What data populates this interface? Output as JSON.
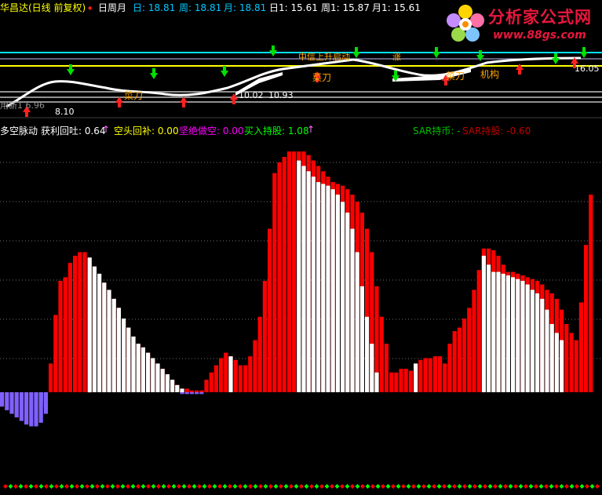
{
  "header": {
    "stock": "华昌达(日线 前复权)",
    "period_label": "日周月",
    "items": [
      {
        "label": "日: 18.81",
        "color": "#00c8ff"
      },
      {
        "label": "周: 18.81",
        "color": "#00c8ff"
      },
      {
        "label": "月: 18.81",
        "color": "#00c8ff"
      },
      {
        "label": "日1: 15.61",
        "color": "#ffffff"
      },
      {
        "label": "周1: 15.87",
        "color": "#ffffff"
      },
      {
        "label": "月1: 15.61",
        "color": "#ffffff"
      }
    ]
  },
  "logo": {
    "name": "分析家公式网",
    "url": "www.88gs.com"
  },
  "upper_labels": {
    "cut1": "菜刀",
    "cut2": "菜刀",
    "cut3": "菜刀",
    "inst": "机构",
    "p1": "8.10",
    "p2": "10.93",
    "p3": "16.05",
    "p4": "10.02",
    "left_text": "用新1 6.96",
    "zhongxin": "中信上升启动",
    "tail": "涨"
  },
  "indicator": {
    "name": "多空脉动",
    "items": [
      {
        "label": "获利回吐: 0.64",
        "color": "#ffffff"
      },
      {
        "label": "空头回补: 0.00",
        "color": "#ffff00"
      },
      {
        "label": "坚绝做空: 0.00",
        "color": "#ff00ff"
      },
      {
        "label": "买入持股: 1.08",
        "color": "#00ff00"
      },
      {
        "label": "SAR持币: -",
        "color": "#00c000"
      },
      {
        "label": "SAR持股: -0.60",
        "color": "#c00000"
      }
    ]
  },
  "chart_data": {
    "type": "bar",
    "title": "多空脉动",
    "series": [
      {
        "name": "买入持股",
        "color": "#ff0000",
        "values": [
          0,
          0,
          0,
          0,
          0,
          0,
          0,
          0,
          0,
          0,
          0.16,
          0.43,
          0.62,
          0.64,
          0.72,
          0.76,
          0.78,
          0.78,
          0.75,
          0.7,
          0.66,
          0.61,
          0.57,
          0.52,
          0.47,
          0.41,
          0.36,
          0.31,
          0.27,
          0.25,
          0.22,
          0.19,
          0.16,
          0.13,
          0.1,
          0.07,
          0.04,
          0.02,
          0.02,
          0.01,
          0.01,
          0.01,
          0.07,
          0.11,
          0.15,
          0.19,
          0.22,
          0.2,
          0.18,
          0.15,
          0.15,
          0.2,
          0.29,
          0.42,
          0.62,
          0.91,
          1.22,
          1.28,
          1.31,
          1.34,
          1.34,
          1.34,
          1.34,
          1.32,
          1.29,
          1.26,
          1.23,
          1.2,
          1.17,
          1.16,
          1.15,
          1.13,
          1.1,
          1.06,
          1,
          0.91,
          0.78,
          0.59,
          0.42,
          0.27,
          0.11,
          0.11,
          0.13,
          0.13,
          0.12,
          0.16,
          0.18,
          0.19,
          0.19,
          0.2,
          0.2,
          0.16,
          0.27,
          0.34,
          0.36,
          0.41,
          0.47,
          0.57,
          0.68,
          0.8,
          0.8,
          0.79,
          0.76,
          0.71,
          0.67,
          0.67,
          0.66,
          0.65,
          0.64,
          0.63,
          0.62,
          0.6,
          0.57,
          0.55,
          0.52,
          0.46,
          0.38,
          0.33,
          0.29,
          0.5,
          0.82,
          1.1
        ]
      },
      {
        "name": "获利回吐",
        "color": "#ffffff",
        "values": [
          0,
          0,
          0,
          0,
          0,
          0,
          0,
          0,
          0,
          0,
          0,
          0,
          0,
          0,
          0,
          0,
          0,
          0,
          0.75,
          0.7,
          0.66,
          0.61,
          0.57,
          0.52,
          0.47,
          0.41,
          0.36,
          0.31,
          0.27,
          0.25,
          0.22,
          0.19,
          0.16,
          0.13,
          0.1,
          0.07,
          0.04,
          0.02,
          0,
          0,
          0,
          0,
          0,
          0,
          0,
          0,
          0,
          0.2,
          0,
          0,
          0,
          0,
          0,
          0,
          0,
          0,
          0,
          0,
          0,
          0,
          0,
          1.29,
          1.26,
          1.23,
          1.2,
          1.17,
          1.16,
          1.15,
          1.13,
          1.1,
          1.06,
          1,
          0.91,
          0.78,
          0.59,
          0.42,
          0.27,
          0.11,
          0,
          0,
          0,
          0,
          0,
          0,
          0,
          0.16,
          0,
          0,
          0,
          0,
          0,
          0,
          0,
          0,
          0,
          0,
          0,
          0,
          0,
          0.76,
          0.71,
          0.67,
          0.67,
          0.66,
          0.65,
          0.64,
          0.63,
          0.62,
          0.6,
          0.57,
          0.55,
          0.52,
          0.46,
          0.38,
          0.33,
          0.29,
          0,
          0,
          0
        ]
      },
      {
        "name": "空头回补",
        "color": "#00c8ff",
        "values": [
          0,
          0,
          0,
          0,
          0,
          0,
          0,
          -0.02,
          -0.05,
          -0.08,
          0,
          0,
          0,
          0,
          0,
          0,
          0,
          0,
          0,
          0,
          0,
          0,
          0,
          0,
          0,
          0,
          0,
          0,
          0,
          0,
          0,
          0,
          0,
          0,
          0,
          0,
          0,
          0,
          0,
          0,
          0,
          0,
          0,
          0,
          0,
          0,
          0,
          0,
          0,
          0,
          0,
          0,
          0,
          0,
          0,
          0,
          0,
          0,
          0,
          0,
          0,
          0,
          0,
          0,
          0,
          0,
          0,
          0,
          0,
          0,
          0,
          0,
          0,
          0,
          0,
          0,
          0,
          0,
          0,
          0,
          0,
          0,
          0,
          0,
          0,
          0,
          0,
          0,
          0,
          0,
          0,
          0,
          0,
          0,
          0,
          0,
          0,
          0,
          0,
          0,
          0,
          0,
          0,
          0,
          0,
          0,
          0,
          0,
          0,
          0,
          0,
          0,
          0,
          0,
          0,
          0,
          0,
          0,
          0,
          0,
          0,
          0,
          0
        ]
      },
      {
        "name": "坚绝做空",
        "color": "#8060ff",
        "values": [
          -0.08,
          -0.1,
          -0.12,
          -0.14,
          -0.16,
          -0.18,
          -0.19,
          -0.19,
          -0.17,
          -0.12,
          0,
          0,
          0,
          0,
          0,
          0,
          0,
          0,
          0,
          0,
          0,
          0,
          0,
          0,
          0,
          0,
          0,
          0,
          0,
          0,
          0,
          0,
          0,
          0,
          0,
          0,
          0,
          -0.01,
          -0.01,
          -0.01,
          -0.01,
          -0.01,
          0,
          0,
          0,
          0,
          0,
          0,
          0,
          0,
          0,
          0,
          0,
          0,
          0,
          0,
          0,
          0,
          0,
          0,
          0,
          0,
          0,
          0,
          0,
          0,
          0,
          0,
          0,
          0,
          0,
          0,
          0,
          0,
          0,
          0,
          0,
          0,
          0,
          0,
          0,
          0,
          0,
          0,
          0,
          0,
          0,
          0,
          0,
          0,
          0,
          0,
          0,
          0,
          0,
          0,
          0,
          0,
          0,
          0,
          0,
          0,
          0,
          0,
          0,
          0,
          0,
          0,
          0,
          0,
          0,
          0,
          0,
          0,
          0,
          0,
          0,
          0,
          0,
          0
        ]
      }
    ],
    "grid": true,
    "lower_marks": {
      "count": 117,
      "colors": [
        "#ff0000",
        "#00ff00"
      ]
    }
  }
}
